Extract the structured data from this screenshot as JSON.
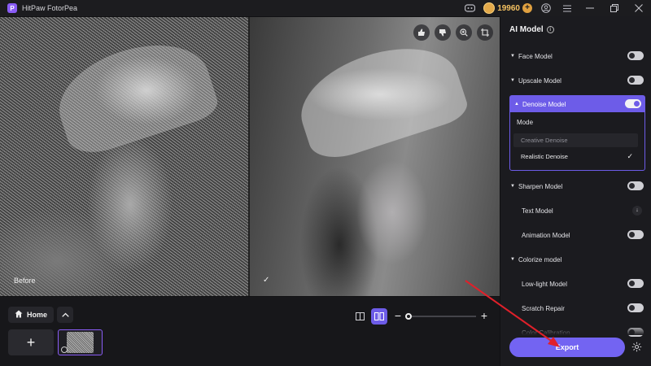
{
  "titlebar": {
    "app_name": "HitPaw FotorPea",
    "logo_letter": "P",
    "coins": "19960",
    "icons": [
      "discord-icon",
      "coin-icon",
      "add-coins-icon",
      "account-icon",
      "menu-icon",
      "minimize-icon",
      "restore-icon",
      "close-icon"
    ]
  },
  "preview": {
    "before_label": "Before",
    "after_check": "✓",
    "tools": [
      "thumbs-up-icon",
      "thumbs-down-icon",
      "zoom-icon",
      "crop-icon"
    ]
  },
  "bottombar": {
    "home_label": "Home",
    "add_label": "+",
    "zoom_minus": "−",
    "zoom_plus": "+",
    "zoom_level": 0.0
  },
  "panel": {
    "title": "AI Model",
    "models": {
      "face": "Face Model",
      "upscale": "Upscale Model",
      "denoise": "Denoise Model",
      "sharpen": "Sharpen Model",
      "text": "Text Model",
      "animation": "Animation Model",
      "colorize": "Colorize model",
      "lowlight": "Low-light Model",
      "scratch": "Scratch Repair",
      "color_calibration": "Color Calibration"
    },
    "denoise_mode": {
      "label": "Mode",
      "options": [
        "Creative Denoise",
        "Realistic Denoise"
      ],
      "selected": "Realistic Denoise"
    },
    "toggles": {
      "face": false,
      "upscale": false,
      "denoise": true,
      "sharpen": false,
      "animation": false,
      "lowlight": false,
      "scratch": false,
      "color_calibration": false
    },
    "export_label": "Export"
  },
  "colors": {
    "accent": "#6d5ce8",
    "export": "#7364f2",
    "coin": "#f4c161",
    "annotation_arrow": "#e0202a"
  }
}
